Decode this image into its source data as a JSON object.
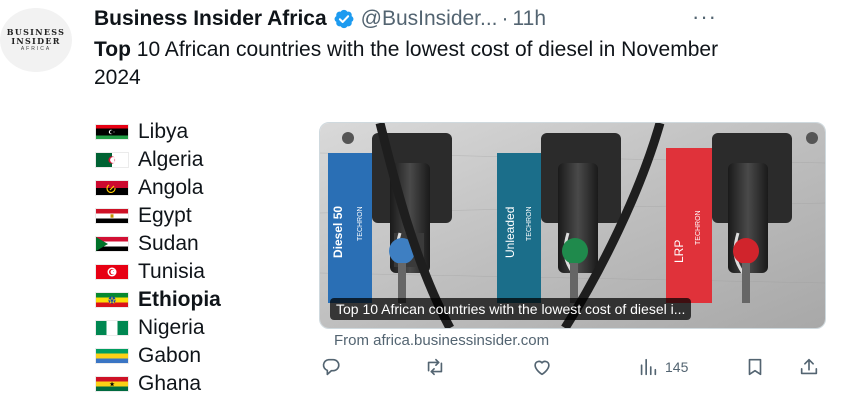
{
  "account": {
    "avatar_line1": "BUSINESS",
    "avatar_line2": "INSIDER",
    "avatar_line3": "AFRICA",
    "name": "Business Insider Africa",
    "handle": "@BusInsider...",
    "separator": "·",
    "time": "11h",
    "more": "···"
  },
  "tweet": {
    "lead": "Top",
    "rest": " 10 African countries with the lowest cost of diesel in November 2024"
  },
  "countries": [
    {
      "name": "Libya",
      "flag": "libya"
    },
    {
      "name": "Algeria",
      "flag": "algeria"
    },
    {
      "name": "Angola",
      "flag": "angola"
    },
    {
      "name": "Egypt",
      "flag": "egypt"
    },
    {
      "name": "Sudan",
      "flag": "sudan"
    },
    {
      "name": "Tunisia",
      "flag": "tunisia"
    },
    {
      "name": "Ethiopia",
      "flag": "ethiopia"
    },
    {
      "name": "Nigeria",
      "flag": "nigeria"
    },
    {
      "name": "Gabon",
      "flag": "gabon"
    },
    {
      "name": "Ghana",
      "flag": "ghana"
    }
  ],
  "card": {
    "caption": "Top 10 African countries with the lowest cost of diesel i...",
    "from": "From africa.businessinsider.com",
    "pump_labels": [
      "Diesel 50",
      "Unleaded",
      "LRP"
    ],
    "pump_sub": [
      "TECHRON",
      "TECHRON",
      "TECHRON"
    ]
  },
  "actions": {
    "reply_icon": "reply-icon",
    "retweet_icon": "retweet-icon",
    "like_icon": "heart-icon",
    "views_icon": "views-icon",
    "views_count": "145",
    "bookmark_icon": "bookmark-icon",
    "share_icon": "share-icon"
  },
  "colors": {
    "verified": "#1d9bf0",
    "pump_blue": "#2a6fb5",
    "pump_teal": "#1b6e8a",
    "pump_red": "#e0323a",
    "muted": "#536471"
  }
}
